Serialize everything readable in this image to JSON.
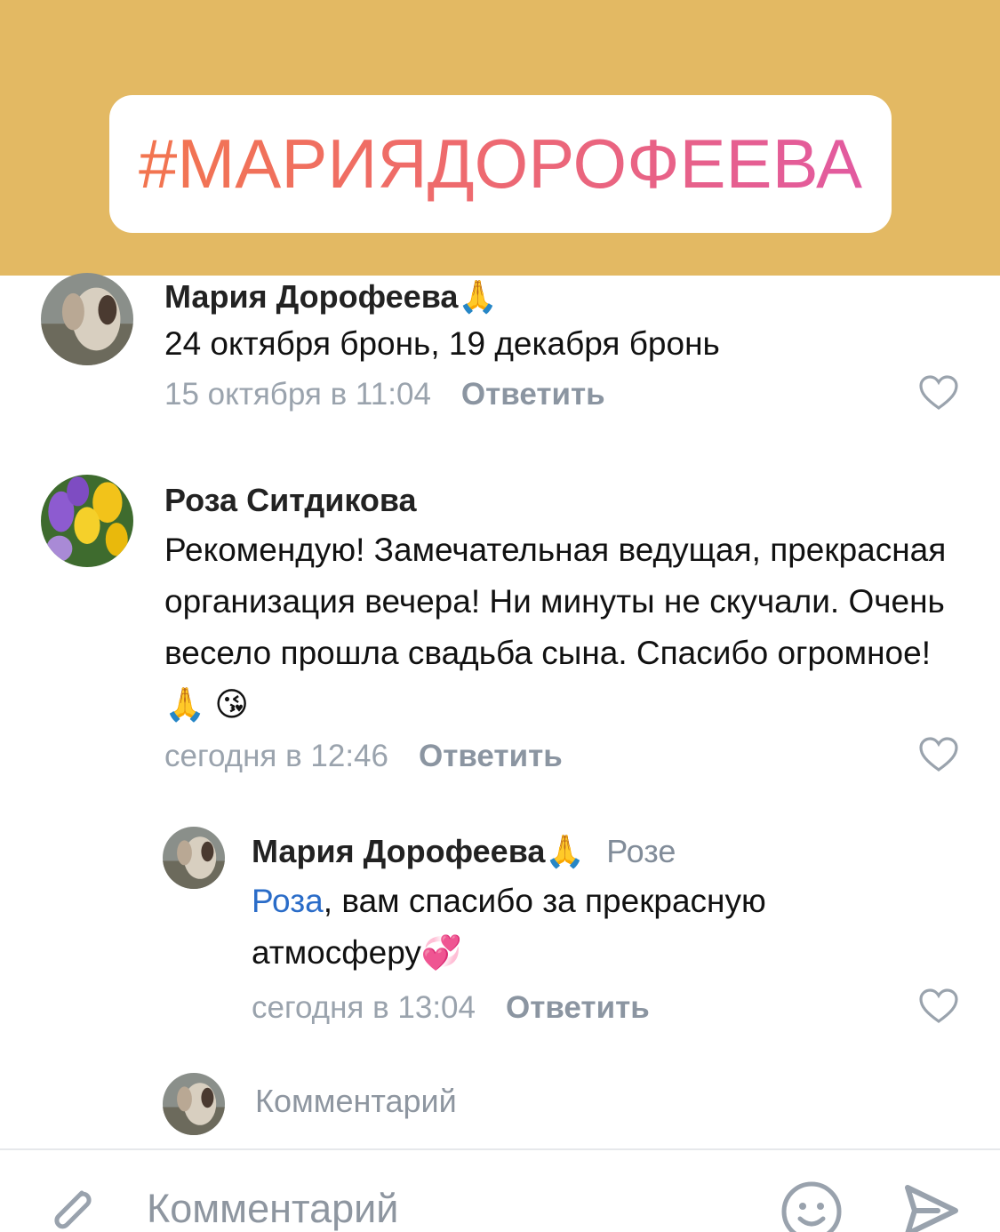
{
  "banner": {
    "hashtag": "#МАРИЯДОРОФЕЕВА",
    "background": "#e3b963"
  },
  "comments": [
    {
      "author": "Мария Дорофеева",
      "author_emoji": "🙏",
      "text": "24 октября бронь, 19 декабря бронь",
      "date": "15 октября в 11:04",
      "reply_label": "Ответить"
    },
    {
      "author": "Роза Ситдикова",
      "text": "Рекомендую! Замечательная  ведущая, прекрасная организация вечера! Ни минуты не скучали. Очень весело прошла свадьба сына. Спасибо огромное! 🙏 😘",
      "date": "сегодня в 12:46",
      "reply_label": "Ответить"
    },
    {
      "author": "Мария Дорофеева",
      "author_emoji": "🙏",
      "reply_to": "Розе",
      "mention": "Роза",
      "text": ", вам спасибо за прекрасную атмосферу💞",
      "date": "сегодня в 13:04",
      "reply_label": "Ответить"
    }
  ],
  "inline_comment_placeholder": "Комментарий",
  "bottom_bar": {
    "placeholder": "Комментарий",
    "icons": [
      "paperclip-icon",
      "smile-icon",
      "send-icon"
    ]
  },
  "colors": {
    "accent_link": "#2a6cc8",
    "meta_gray": "#9aa3ad",
    "hashtag_gradient": [
      "#f2754f",
      "#e25aa0"
    ]
  }
}
